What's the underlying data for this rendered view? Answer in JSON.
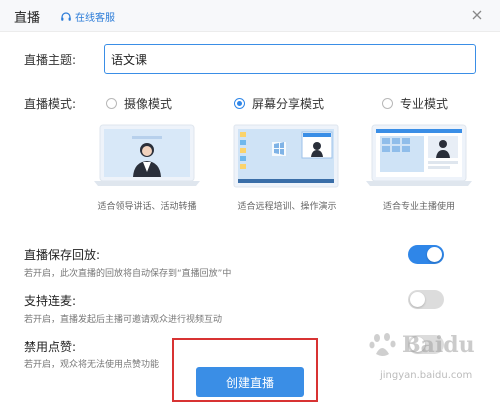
{
  "header": {
    "title": "直播",
    "service_label": "在线客服"
  },
  "topic": {
    "label": "直播主题:",
    "value": "语文课"
  },
  "mode": {
    "label": "直播模式:",
    "options": [
      {
        "label": "摄像模式",
        "caption": "适合领导讲话、活动转播",
        "selected": false
      },
      {
        "label": "屏幕分享模式",
        "caption": "适合远程培训、操作演示",
        "selected": true
      },
      {
        "label": "专业模式",
        "caption": "适合专业主播使用",
        "selected": false
      }
    ]
  },
  "settings": [
    {
      "title": "直播保存回放:",
      "desc": "若开启，此次直播的回放将自动保存到“直播回放”中",
      "enabled": true
    },
    {
      "title": "支持连麦:",
      "desc": "若开启，直播发起后主播可邀请观众进行视频互动",
      "enabled": false
    },
    {
      "title": "禁用点赞:",
      "desc": "若开启，观众将无法使用点赞功能",
      "enabled": false
    }
  ],
  "actions": {
    "create_label": "创建直播"
  },
  "watermark": {
    "brand": "Baidu",
    "url": "jingyan.baidu.com"
  },
  "colors": {
    "accent": "#2f86e8",
    "highlight_box": "#d83333"
  },
  "icons": {
    "service": "headset-icon",
    "close": "close-icon"
  }
}
